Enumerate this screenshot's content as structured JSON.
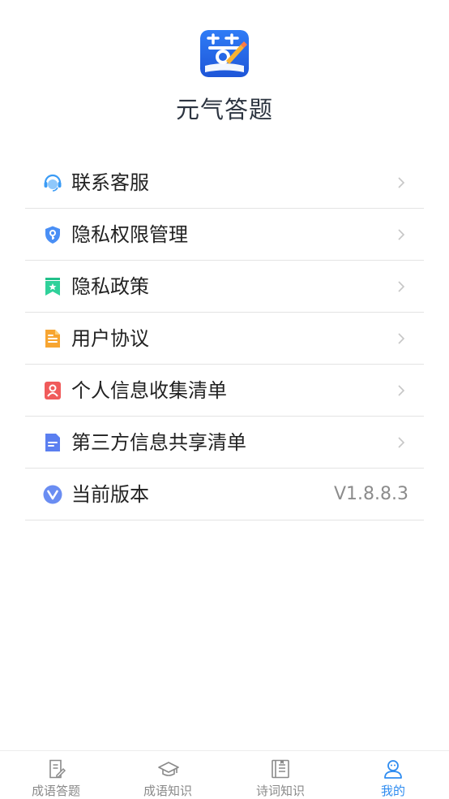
{
  "app": {
    "name": "元气答题",
    "logo_icon": "answer-app-logo-icon"
  },
  "menu": [
    {
      "label": "联系客服",
      "icon": "customer-service-headset-icon"
    },
    {
      "label": "隐私权限管理",
      "icon": "shield-key-icon"
    },
    {
      "label": "隐私政策",
      "icon": "bookmark-star-icon"
    },
    {
      "label": "用户协议",
      "icon": "document-icon"
    },
    {
      "label": "个人信息收集清单",
      "icon": "person-card-icon"
    },
    {
      "label": "第三方信息共享清单",
      "icon": "list-document-icon"
    },
    {
      "label": "当前版本",
      "icon": "version-v-icon",
      "value": "V1.8.8.3"
    }
  ],
  "tabbar": {
    "items": [
      {
        "label": "成语答题",
        "icon": "quiz-paper-icon",
        "active": false
      },
      {
        "label": "成语知识",
        "icon": "graduation-cap-icon",
        "active": false
      },
      {
        "label": "诗词知识",
        "icon": "book-icon",
        "active": false
      },
      {
        "label": "我的",
        "icon": "user-icon",
        "active": true
      }
    ]
  },
  "colors": {
    "accent": "#2f8cf0",
    "text_primary": "#222222",
    "text_secondary": "#8c8c8c",
    "divider": "#e3e3e3"
  }
}
